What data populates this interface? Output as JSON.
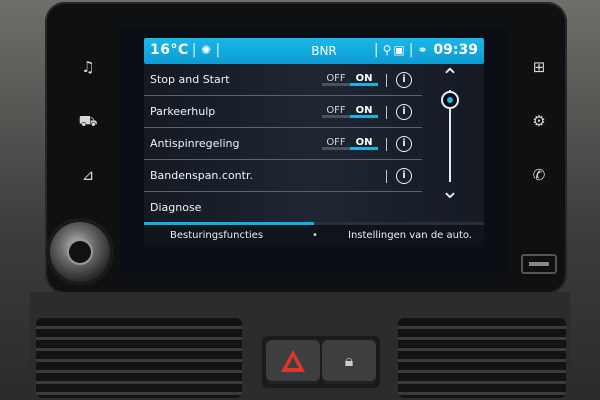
{
  "status_bar": {
    "temperature": "16°C",
    "title": "BNR",
    "time": "09:39",
    "separator": "|"
  },
  "settings": [
    {
      "label": "Stop and Start",
      "has_toggle": true,
      "off_label": "OFF",
      "on_label": "ON",
      "state": "ON"
    },
    {
      "label": "Parkeerhulp",
      "has_toggle": true,
      "off_label": "OFF",
      "on_label": "ON",
      "state": "ON"
    },
    {
      "label": "Antispinregeling",
      "has_toggle": true,
      "off_label": "OFF",
      "on_label": "ON",
      "state": "ON"
    },
    {
      "label": "Bandenspan.contr.",
      "has_toggle": false
    },
    {
      "label": "Diagnose",
      "has_toggle": false
    }
  ],
  "info_glyph": "i",
  "scroll": {
    "up_glyph": "⌃",
    "down_glyph": "⌄"
  },
  "tabs": {
    "left": "Besturingsfuncties",
    "separator": "•",
    "right": "Instellingen van de auto.",
    "progress_fraction": 0.5
  },
  "side_buttons": {
    "music": "♫",
    "car": "⛟",
    "nav": "⊿",
    "apps": "⊞",
    "settings": "⚙",
    "phone": "✆"
  },
  "colors": {
    "accent": "#12b0e3",
    "status_bar": "#0e9bd1",
    "hazard": "#e3332b"
  }
}
